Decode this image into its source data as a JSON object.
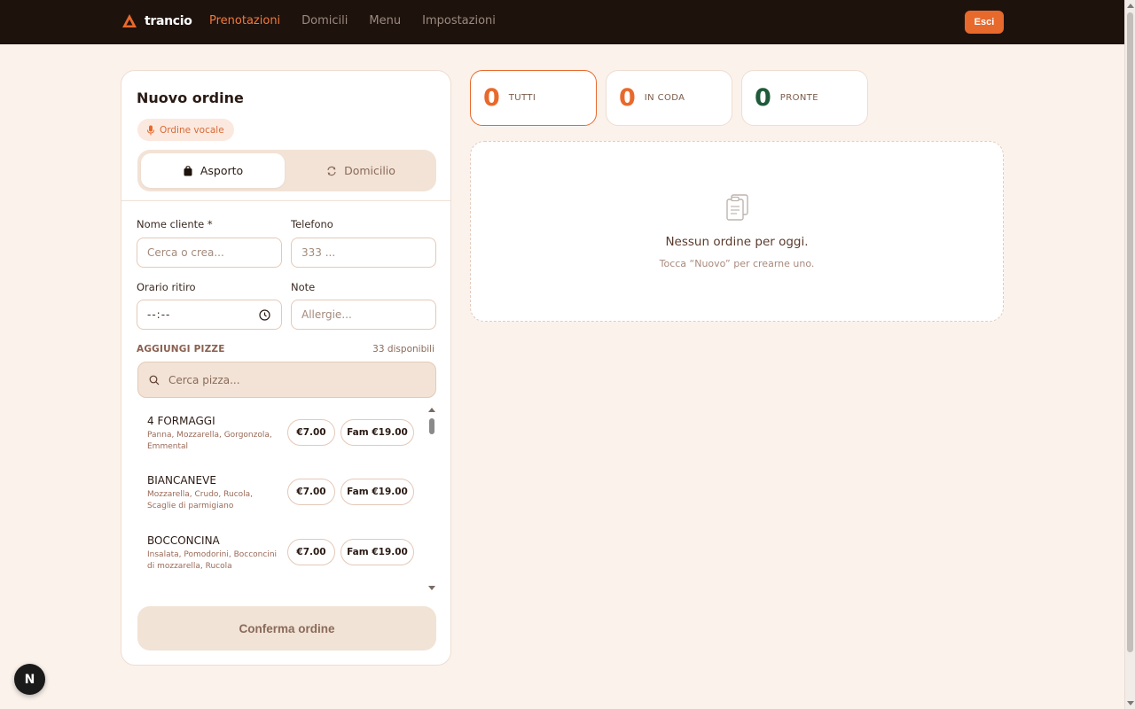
{
  "header": {
    "brand": "trancio",
    "nav": [
      "Prenotazioni",
      "Domicili",
      "Menu",
      "Impostazioni"
    ],
    "active_nav": "Prenotazioni",
    "exit_label": "Esci"
  },
  "order_form": {
    "title": "Nuovo ordine",
    "voice_label": "Ordine vocale",
    "modes": {
      "takeaway": "Asporto",
      "delivery": "Domicilio",
      "selected": "Asporto"
    },
    "customer_label": "Nome cliente *",
    "customer_placeholder": "Cerca o crea...",
    "phone_label": "Telefono",
    "phone_placeholder": "333 ...",
    "pickup_label": "Orario ritiro",
    "pickup_value": "--:--",
    "notes_label": "Note",
    "notes_placeholder": "Allergie...",
    "pizzas_heading": "AGGIUNGI PIZZE",
    "available_text": "33 disponibili",
    "pizza_search_placeholder": "Cerca pizza...",
    "pizzas": [
      {
        "name": "4 FORMAGGI",
        "desc": "Panna, Mozzarella, Gorgonzola, Emmental",
        "price": "€7.00",
        "family_price": "Fam €19.00"
      },
      {
        "name": "BIANCANEVE",
        "desc": "Mozzarella, Crudo, Rucola, Scaglie di parmigiano",
        "price": "€7.00",
        "family_price": "Fam €19.00"
      },
      {
        "name": "BOCCONCINA",
        "desc": "Insalata, Pomodorini, Bocconcini di mozzarella, Rucola",
        "price": "€7.00",
        "family_price": "Fam €19.00"
      }
    ],
    "confirm_label": "Conferma ordine"
  },
  "stats": [
    {
      "count": "0",
      "label": "TUTTI",
      "color": "#e8692c"
    },
    {
      "count": "0",
      "label": "IN CODA",
      "color": "#e8692c"
    },
    {
      "count": "0",
      "label": "PRONTE",
      "color": "#1f5a3a"
    }
  ],
  "empty_state": {
    "title": "Nessun ordine per oggi.",
    "subtitle": "Tocca “Nuovo” per crearne uno."
  },
  "dev_badge": "N",
  "colors": {
    "accent": "#e8692c",
    "topbar": "#1e120d",
    "background": "#fbf2ec"
  }
}
